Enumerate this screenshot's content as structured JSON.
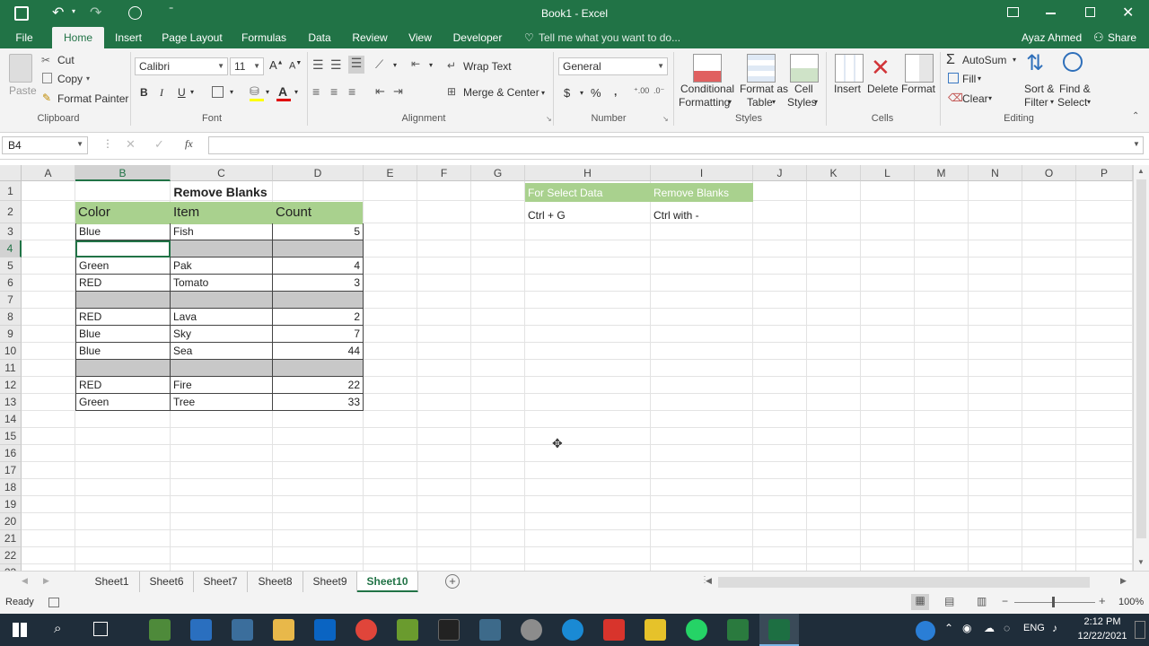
{
  "window": {
    "title": "Book1 - Excel",
    "user": "Ayaz Ahmed",
    "share_label": "Share"
  },
  "ribbon_tabs": [
    "File",
    "Home",
    "Insert",
    "Page Layout",
    "Formulas",
    "Data",
    "Review",
    "View",
    "Developer"
  ],
  "tell_me": "Tell me what you want to do...",
  "clipboard": {
    "paste": "Paste",
    "cut": "Cut",
    "copy": "Copy",
    "format_painter": "Format Painter",
    "label": "Clipboard"
  },
  "font": {
    "name": "Calibri",
    "size": "11",
    "label": "Font",
    "bold": "B",
    "italic": "I",
    "underline": "U"
  },
  "alignment": {
    "wrap": "Wrap Text",
    "merge": "Merge & Center",
    "label": "Alignment"
  },
  "number": {
    "format": "General",
    "label": "Number",
    "currency": "$",
    "percent": "%"
  },
  "styles": {
    "conditional": "Conditional",
    "formatting": "Formatting",
    "format_as": "Format as",
    "table": "Table",
    "cell": "Cell",
    "styles": "Styles",
    "label": "Styles"
  },
  "cells": {
    "insert": "Insert",
    "delete": "Delete",
    "format": "Format",
    "label": "Cells"
  },
  "editing": {
    "autosum": "AutoSum",
    "fill": "Fill",
    "clear": "Clear",
    "sort": "Sort &",
    "filter": "Filter",
    "find": "Find &",
    "select": "Select",
    "label": "Editing"
  },
  "formula_bar": {
    "name_box": "B4",
    "fx": "fx",
    "value": ""
  },
  "columns": [
    "A",
    "B",
    "C",
    "D",
    "E",
    "F",
    "G",
    "H",
    "I",
    "J",
    "K",
    "L",
    "M",
    "N",
    "O",
    "P"
  ],
  "rows": [
    "1",
    "2",
    "3",
    "4",
    "5",
    "6",
    "7",
    "8",
    "9",
    "10",
    "11",
    "12",
    "13",
    "14",
    "15",
    "16",
    "17",
    "18",
    "19",
    "20",
    "21",
    "22",
    "23"
  ],
  "sheet": {
    "title": "Remove Blanks",
    "headers": {
      "color": "Color",
      "item": "Item",
      "count": "Count"
    },
    "rows": [
      {
        "color": "Blue",
        "item": "Fish",
        "count": "5"
      },
      {
        "color": "",
        "item": "",
        "count": ""
      },
      {
        "color": "Green",
        "item": "Pak",
        "count": "4"
      },
      {
        "color": "RED",
        "item": "Tomato",
        "count": "3"
      },
      {
        "color": "",
        "item": "",
        "count": ""
      },
      {
        "color": "RED",
        "item": "Lava",
        "count": "2"
      },
      {
        "color": "Blue",
        "item": "Sky",
        "count": "7"
      },
      {
        "color": "Blue",
        "item": "Sea",
        "count": "44"
      },
      {
        "color": "",
        "item": "",
        "count": ""
      },
      {
        "color": "RED",
        "item": "Fire",
        "count": "22"
      },
      {
        "color": "Green",
        "item": "Tree",
        "count": "33"
      }
    ],
    "notes": {
      "h1": "For Select Data",
      "i1": "Remove Blanks",
      "h2": "Ctrl + G",
      "i2": "Ctrl with -"
    }
  },
  "sheet_tabs": [
    "Sheet1",
    "Sheet6",
    "Sheet7",
    "Sheet8",
    "Sheet9",
    "Sheet10"
  ],
  "active_sheet": "Sheet10",
  "status": {
    "ready": "Ready",
    "zoom": "100%"
  },
  "taskbar": {
    "time": "2:12 PM",
    "date": "12/22/2021",
    "lang": "ENG"
  },
  "colors": {
    "excel_green": "#217346",
    "header_fill": "#a9d18e",
    "blank_fill": "#c8c8c8"
  }
}
